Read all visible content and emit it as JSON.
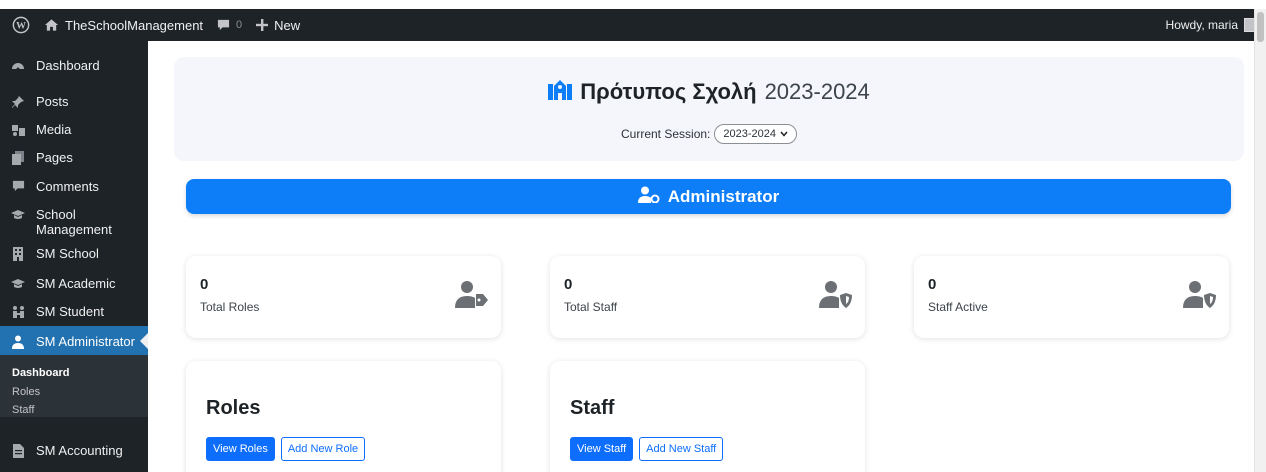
{
  "adminbar": {
    "site_name": "TheSchoolManagement",
    "comments_count": "0",
    "new_label": "New",
    "howdy": "Howdy, maria"
  },
  "sidebar": {
    "items": [
      {
        "label": "Dashboard",
        "icon": "dashboard-icon"
      },
      {
        "label": "Posts",
        "icon": "pin-icon"
      },
      {
        "label": "Media",
        "icon": "media-icon"
      },
      {
        "label": "Pages",
        "icon": "pages-icon"
      },
      {
        "label": "Comments",
        "icon": "comment-icon"
      },
      {
        "label": "School Management",
        "icon": "graduation-cap-icon"
      },
      {
        "label": "SM School",
        "icon": "building-icon"
      },
      {
        "label": "SM Academic",
        "icon": "graduation-cap-icon"
      },
      {
        "label": "SM Student",
        "icon": "students-icon"
      },
      {
        "label": "SM Administrator",
        "icon": "admin-user-icon"
      },
      {
        "label": "SM Accounting",
        "icon": "document-icon"
      }
    ],
    "submenu": [
      "Dashboard",
      "Roles",
      "Staff"
    ]
  },
  "header": {
    "school_name": "Πρότυπος Σχολή",
    "school_year": "2023-2024",
    "session_label": "Current Session:",
    "session_value": "2023-2024"
  },
  "banner": {
    "title": "Administrator"
  },
  "stats": [
    {
      "value": "0",
      "label": "Total Roles",
      "icon": "user-tag-icon"
    },
    {
      "value": "0",
      "label": "Total Staff",
      "icon": "user-shield-icon"
    },
    {
      "value": "0",
      "label": "Staff Active",
      "icon": "user-shield-icon"
    }
  ],
  "panels": {
    "roles": {
      "title": "Roles",
      "primary": "View Roles",
      "secondary": "Add New Role"
    },
    "staff": {
      "title": "Staff",
      "primary": "View Staff",
      "secondary": "Add New Staff"
    }
  },
  "colors": {
    "adminbar": "#1d2327",
    "accent_blue": "#0d7ef8",
    "wp_active": "#2271b1"
  }
}
